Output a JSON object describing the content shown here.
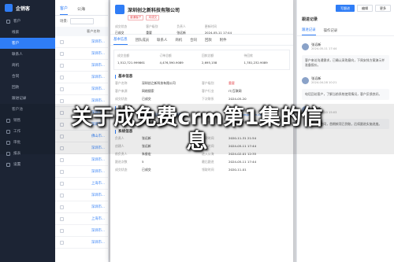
{
  "app": {
    "name": "企销客"
  },
  "sidebar": {
    "items": [
      {
        "label": "客户",
        "sub": false,
        "active": false
      },
      {
        "label": "线索",
        "sub": true,
        "active": false
      },
      {
        "label": "客户",
        "sub": true,
        "active": true
      },
      {
        "label": "联系人",
        "sub": true,
        "active": false
      },
      {
        "label": "商机",
        "sub": true,
        "active": false
      },
      {
        "label": "合同",
        "sub": true,
        "active": false
      },
      {
        "label": "回款",
        "sub": true,
        "active": false
      },
      {
        "label": "跟进记录",
        "sub": true,
        "active": false
      },
      {
        "label": "客户池",
        "sub": true,
        "active": false
      },
      {
        "label": "销售",
        "sub": false,
        "active": false
      },
      {
        "label": "工作",
        "sub": false,
        "active": false
      },
      {
        "label": "审批",
        "sub": false,
        "active": false
      },
      {
        "label": "报表",
        "sub": false,
        "active": false
      },
      {
        "label": "设置",
        "sub": false,
        "active": false
      }
    ]
  },
  "list": {
    "tabs": [
      "客户",
      "公海"
    ],
    "filter_label": "场景:",
    "column_header": "客户名称",
    "rows": [
      "深圳市...",
      "深圳市...",
      "深圳市...",
      "深圳市...",
      "深圳市...",
      "深圳市...",
      "深圳市...",
      "深圳市...",
      "佛山市...",
      "深圳市...",
      "深圳市...",
      "深圳市...",
      "上海市...",
      "深圳市...",
      "深圳市...",
      "上海市...",
      "深圳市...",
      "深圳市..."
    ]
  },
  "drawer": {
    "company": "深圳创之新科技有限公司",
    "badges": [
      "普通客户",
      "未成交"
    ],
    "meta": [
      {
        "label": "成交状态",
        "value": "已成交"
      },
      {
        "label": "客户级别",
        "value": "重要"
      },
      {
        "label": "负责人",
        "value": "张远新"
      },
      {
        "label": "更新时间",
        "value": "2024-05-11 17:44"
      }
    ],
    "tabs": [
      "基本信息",
      "团队成员",
      "联系人",
      "商机",
      "合同",
      "回款",
      "附件"
    ],
    "stats": [
      {
        "label": "成交金额",
        "value": "1,512,721.999861"
      },
      {
        "label": "订单总额",
        "value": "4,476,590.9089"
      },
      {
        "label": "回款总额",
        "value": "2,695,158"
      },
      {
        "label": "待回款",
        "value": "1,781,232.9089"
      }
    ],
    "section_basic": "基本信息",
    "basic_fields": [
      {
        "k": "客户名称",
        "v": "深圳创之新科技有限公司",
        "style": ""
      },
      {
        "k": "客户级别",
        "v": "重要",
        "style": "red"
      },
      {
        "k": "客户来源",
        "v": "网络搜索",
        "style": ""
      },
      {
        "k": "客户行业",
        "v": "IT/互联网",
        "style": ""
      },
      {
        "k": "成交状态",
        "v": "已成交",
        "style": ""
      },
      {
        "k": "下次联系",
        "v": "2024-05-20",
        "style": ""
      }
    ],
    "section_contact": "联系信息",
    "contact_fields": [
      {
        "k": "详细地址",
        "v": "深圳市南山区西丽南岗创新路5号",
        "style": "link"
      },
      {
        "k": "客户网址",
        "v": "www.chuangzhixin.com",
        "style": "link"
      },
      {
        "k": "联系地址",
        "v": "深圳市南山区西丽南岗",
        "style": ""
      },
      {
        "k": "所在地区",
        "v": "广东省深圳市南山区",
        "style": ""
      }
    ],
    "section_system": "系统信息",
    "system_fields": [
      {
        "k": "负责人",
        "v": "张远新",
        "style": ""
      },
      {
        "k": "创建时间",
        "v": "2020-11-31 21:54",
        "style": ""
      },
      {
        "k": "创建人",
        "v": "张远新",
        "style": ""
      },
      {
        "k": "更新时间",
        "v": "2024-05-11 17:44",
        "style": ""
      },
      {
        "k": "前负责人",
        "v": "朱俊宏",
        "style": ""
      },
      {
        "k": "进入公海",
        "v": "2024-02-01 12:35",
        "style": ""
      },
      {
        "k": "跟进次数",
        "v": "5",
        "style": ""
      },
      {
        "k": "最后跟进",
        "v": "2024-05-11 17:44",
        "style": ""
      },
      {
        "k": "成交状态",
        "v": "已成交",
        "style": ""
      },
      {
        "k": "领取时间",
        "v": "2020-11-01",
        "style": ""
      }
    ]
  },
  "right": {
    "actions": [
      "写跟进",
      "编辑",
      "更多"
    ],
    "title": "跟进记录",
    "tabs": [
      "跟进记录",
      "操作记录"
    ],
    "records": [
      {
        "who": "张远新",
        "when": "2024-05-11 17:44",
        "text": "客户来访沟通需求，已确认采购意向，下周安排方案演示并准备报价。"
      },
      {
        "who": "张远新",
        "when": "2024-04-28 10:21",
        "text": "电话回访客户，了解当前系统使用情况，客户反馈良好。"
      },
      {
        "who": "张远新",
        "when": "2024-04-10 15:03",
        "text": "客户已签署合同，首期款项已到账，后续跟进实施进度。"
      }
    ]
  },
  "overlay_title": {
    "line1": "关于成免费crm第1集的信",
    "line2": "息"
  }
}
